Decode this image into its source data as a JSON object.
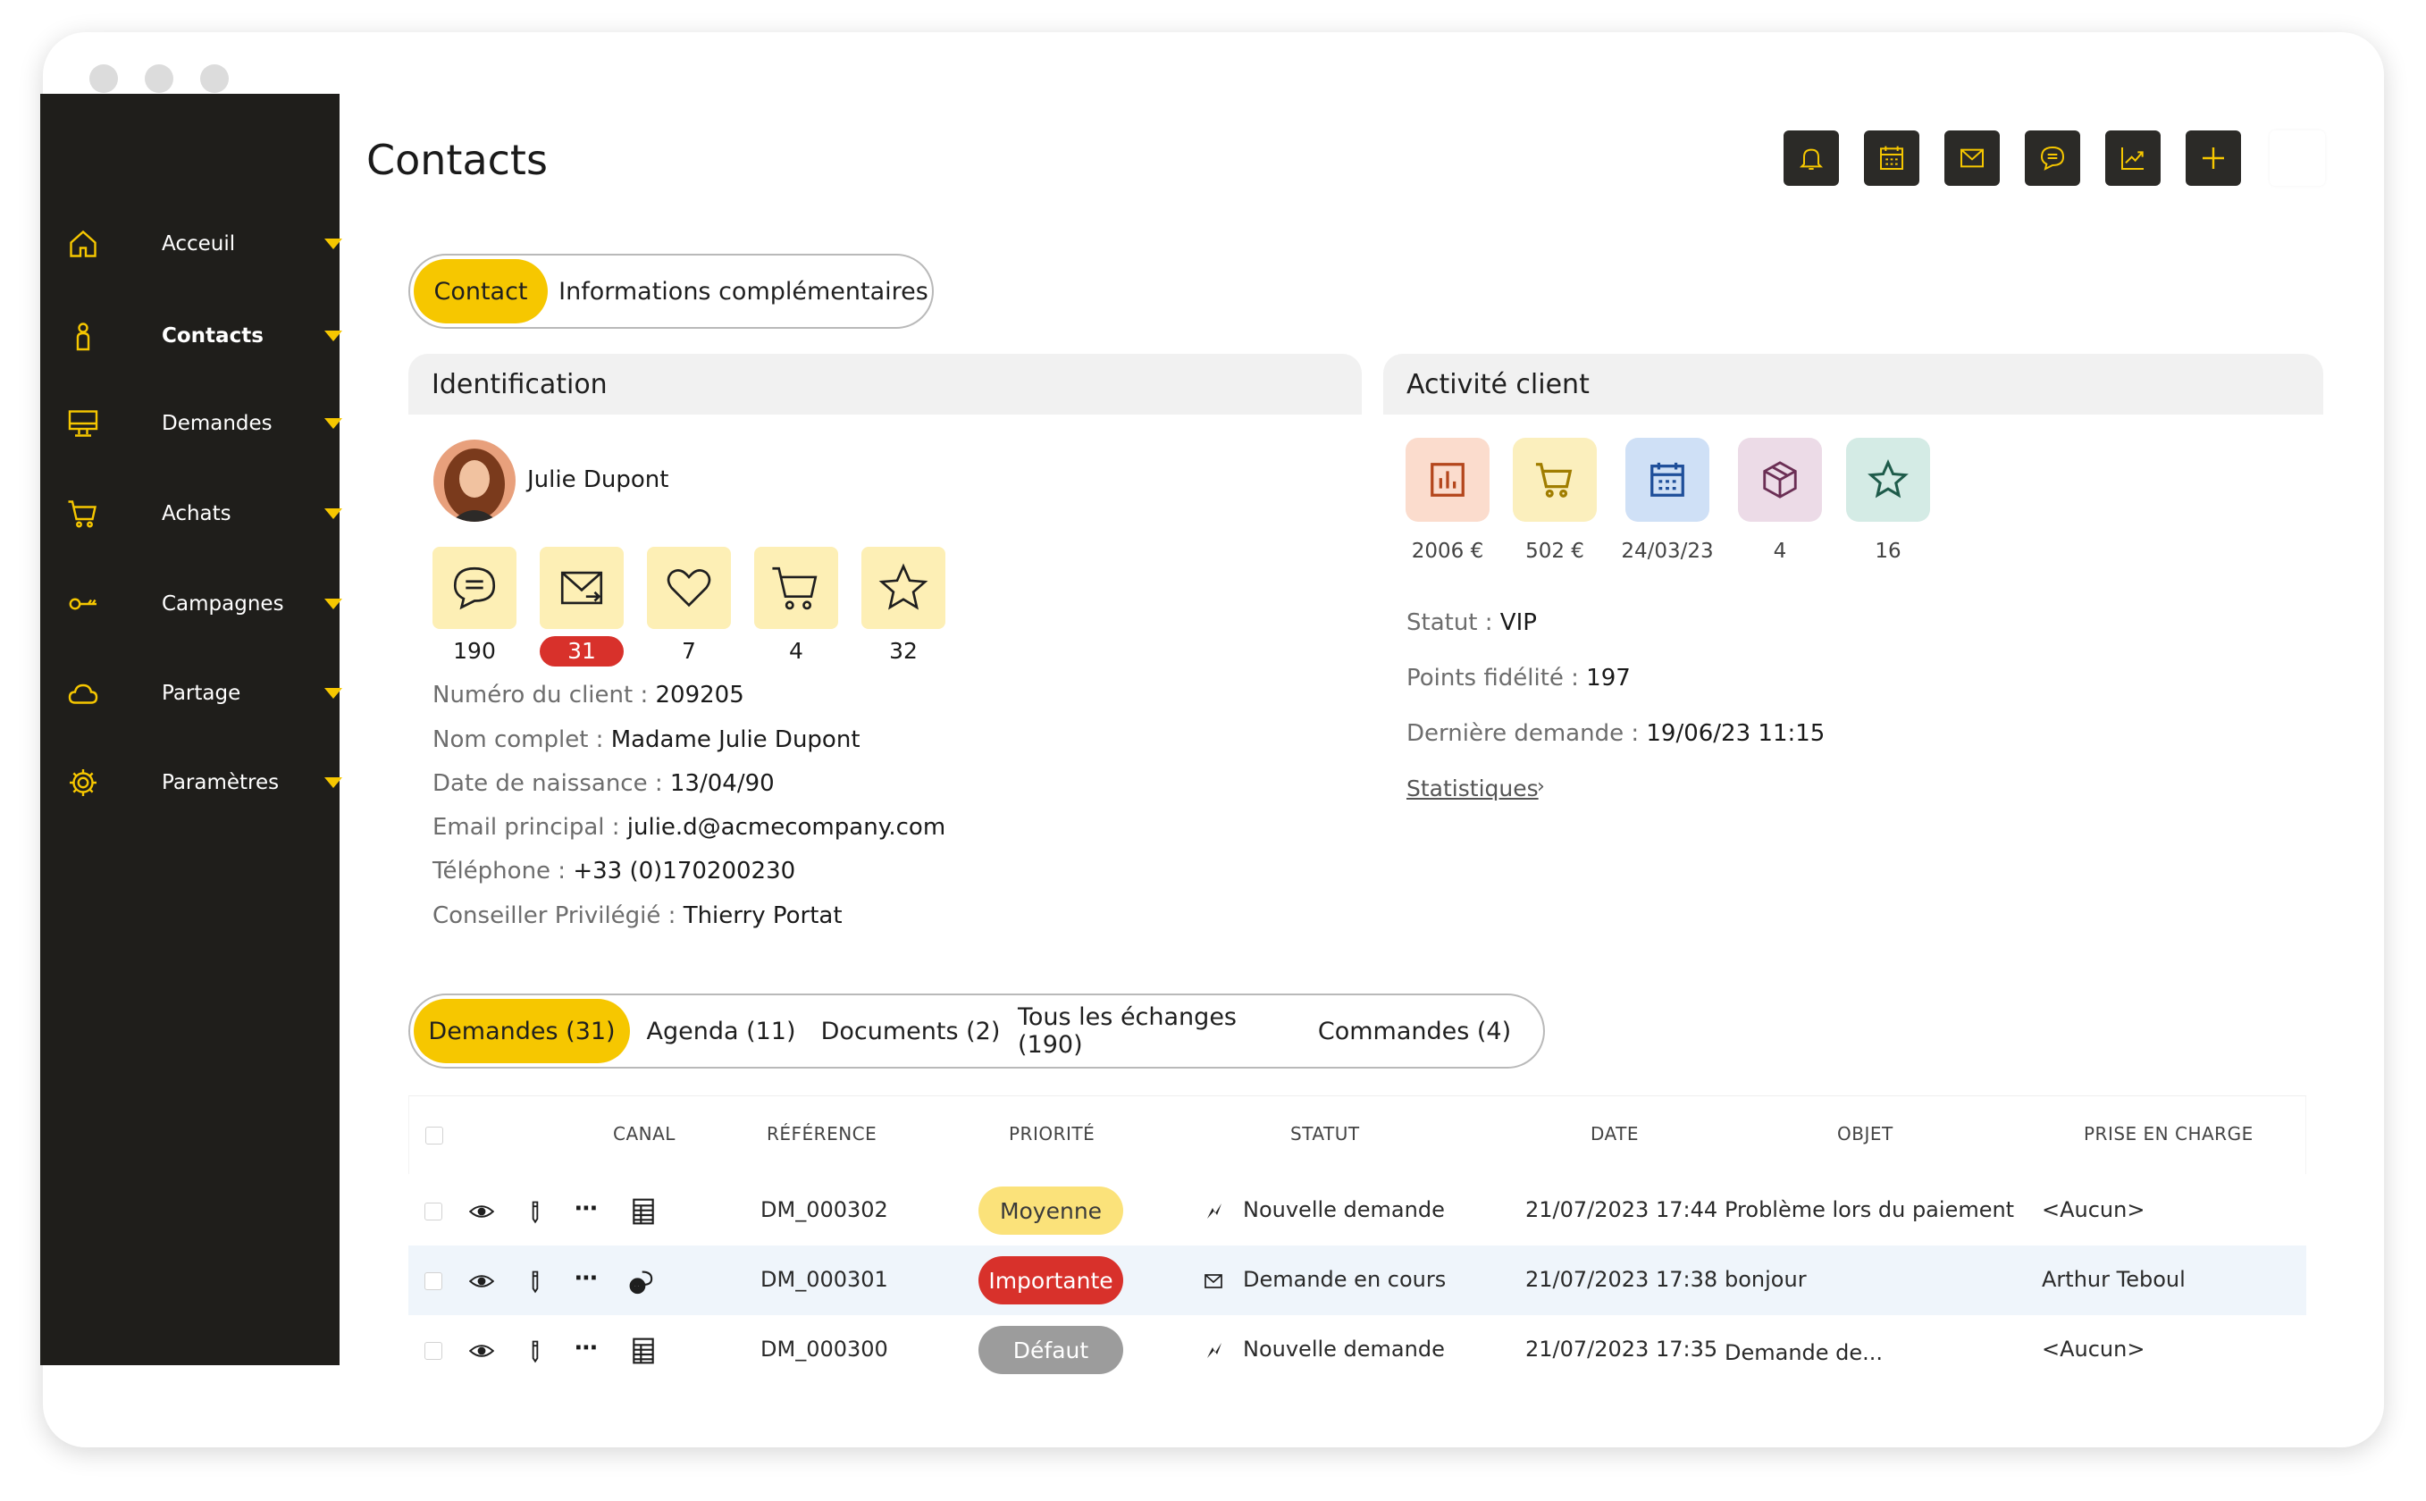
{
  "colors": {
    "accent": "#f6c700",
    "sidebar": "#1f1e1b",
    "danger": "#d8312b",
    "neutral": "#9c9c9c"
  },
  "sidebar": {
    "items": [
      {
        "label": "Acceuil",
        "icon": "home-icon"
      },
      {
        "label": "Contacts",
        "icon": "person-icon",
        "active": true
      },
      {
        "label": "Demandes",
        "icon": "monitor-icon"
      },
      {
        "label": "Achats",
        "icon": "cart-icon"
      },
      {
        "label": "Campagnes",
        "icon": "key-icon"
      },
      {
        "label": "Partage",
        "icon": "cloud-icon"
      },
      {
        "label": "Paramètres",
        "icon": "gear-icon"
      }
    ]
  },
  "header": {
    "title": "Contacts",
    "toolbar": [
      "bell-icon",
      "calendar-icon",
      "mail-icon",
      "chat-icon",
      "chart-icon",
      "plus-icon"
    ]
  },
  "top_tabs": [
    {
      "label": "Contact",
      "active": true
    },
    {
      "label": "Informations complémentaires"
    }
  ],
  "identification": {
    "title": "Identification",
    "name": "Julie Dupont",
    "stats": [
      {
        "icon": "chat-icon",
        "value": "190"
      },
      {
        "icon": "mail-icon",
        "value": "31",
        "badge": true
      },
      {
        "icon": "heart-icon",
        "value": "7"
      },
      {
        "icon": "cart-icon",
        "value": "4"
      },
      {
        "icon": "star-icon",
        "value": "32"
      }
    ],
    "fields": [
      {
        "label": "Numéro du client : ",
        "value": "209205"
      },
      {
        "label": "Nom complet : ",
        "value": " Madame Julie Dupont"
      },
      {
        "label": "Date de naissance : ",
        "value": "13/04/90"
      },
      {
        "label": "Email principal : ",
        "value": "julie.d@acmecompany.com"
      },
      {
        "label": "Téléphone : ",
        "value": "+33 (0)170200230"
      },
      {
        "label": "Conseiller Privilégié : ",
        "value": "Thierry Portat"
      }
    ]
  },
  "activity": {
    "title": "Activité client",
    "tiles": [
      {
        "icon": "bar-chart-icon",
        "value": "2006 €",
        "bg": "#fbdccd",
        "fg": "#b4461c"
      },
      {
        "icon": "cart-icon",
        "value": "502 €",
        "bg": "#fbefbd",
        "fg": "#a07d00"
      },
      {
        "icon": "calendar-icon",
        "value": "24/03/23",
        "bg": "#cfe0f6",
        "fg": "#1f4f9a"
      },
      {
        "icon": "box-icon",
        "value": "4",
        "bg": "#ecdbe7",
        "fg": "#6b2f55"
      },
      {
        "icon": "star-icon",
        "value": "16",
        "bg": "#d4ebe5",
        "fg": "#1e5b4a"
      }
    ],
    "fields": [
      {
        "label": "Statut : ",
        "value": "VIP"
      },
      {
        "label": "Points fidélité : ",
        "value": "197"
      },
      {
        "label": "Dernière demande : ",
        "value": "19/06/23  11:15"
      }
    ],
    "link": "Statistiques"
  },
  "bottom_tabs": [
    {
      "label": "Demandes (31)",
      "active": true
    },
    {
      "label": "Agenda (11)"
    },
    {
      "label": "Documents (2)"
    },
    {
      "label": "Tous les échanges (190)"
    },
    {
      "label": "Commandes (4)"
    }
  ],
  "table": {
    "headers": [
      "CANAL",
      "RÉFÉRENCE",
      "PRIORITÉ",
      "STATUT",
      "DATE",
      "OBJET",
      "PRISE EN CHARGE"
    ],
    "rows": [
      {
        "canal": "form-icon",
        "ref": "DM_000302",
        "priority": "Moyenne",
        "priority_bg": "#fbe27a",
        "priority_fg": "#3a3a3a",
        "status_icon": "new-icon",
        "status": "Nouvelle demande",
        "date": "21/07/2023 17:44",
        "object": "Problème lors du paiement",
        "owner": "<Aucun>"
      },
      {
        "canal": "chat-icon",
        "ref": "DM_000301",
        "priority": "Importante",
        "priority_bg": "#d8312b",
        "priority_fg": "#ffffff",
        "status_icon": "mail-icon",
        "status": "Demande en cours",
        "date": "21/07/2023 17:38",
        "object": "bonjour",
        "owner": "Arthur Teboul"
      },
      {
        "canal": "form-icon",
        "ref": "DM_000300",
        "priority": "Défaut",
        "priority_bg": "#9c9c9c",
        "priority_fg": "#ffffff",
        "status_icon": "new-icon",
        "status": "Nouvelle demande",
        "date": "21/07/2023 17:35",
        "object": "Demande de...",
        "owner": "<Aucun>"
      }
    ]
  }
}
